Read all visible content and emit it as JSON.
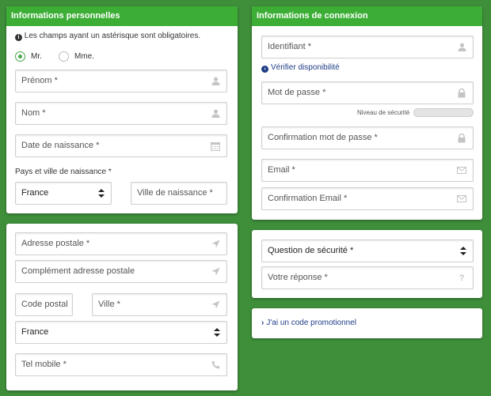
{
  "personal": {
    "title": "Informations personnelles",
    "required_note": "Les champs ayant un astérisque sont obligatoires.",
    "civility": [
      {
        "label": "Mr.",
        "selected": true
      },
      {
        "label": "Mme.",
        "selected": false
      }
    ],
    "firstname_ph": "Prénom *",
    "lastname_ph": "Nom *",
    "birthdate_ph": "Date de naissance *",
    "birth_place_label": "Pays et ville de naissance *",
    "birth_country": "France",
    "birth_city_ph": "Ville de naissance *"
  },
  "address": {
    "street_ph": "Adresse postale *",
    "complement_ph": "Complément adresse postale",
    "postcode_ph": "Code postal",
    "city_ph": "Ville *",
    "country": "France",
    "mobile_ph": "Tel mobile *"
  },
  "login": {
    "title": "Informations de connexion",
    "username_ph": "Identifiant *",
    "check_label": "Vérifier disponibilité",
    "password_ph": "Mot de passe *",
    "strength_label": "Niveau de sécurité",
    "strength_level": 0,
    "confirm_ph": "Confirmation mot de passe *",
    "email_ph": "Email *",
    "confirm_email_ph": "Confirmation Email *"
  },
  "security": {
    "question": "Question de sécurité *",
    "answer_ph": "Votre réponse *"
  },
  "promo": {
    "label": "J'ai un code promotionnel"
  },
  "colors": {
    "background": "#3e8e3a",
    "header": "#3cae36",
    "link": "#1f3c88"
  },
  "icons": [
    "user-icon",
    "calendar-icon",
    "location-arrow-icon",
    "phone-icon",
    "lock-icon",
    "envelope-icon",
    "question-icon",
    "info-icon",
    "chevron-right-icon"
  ]
}
